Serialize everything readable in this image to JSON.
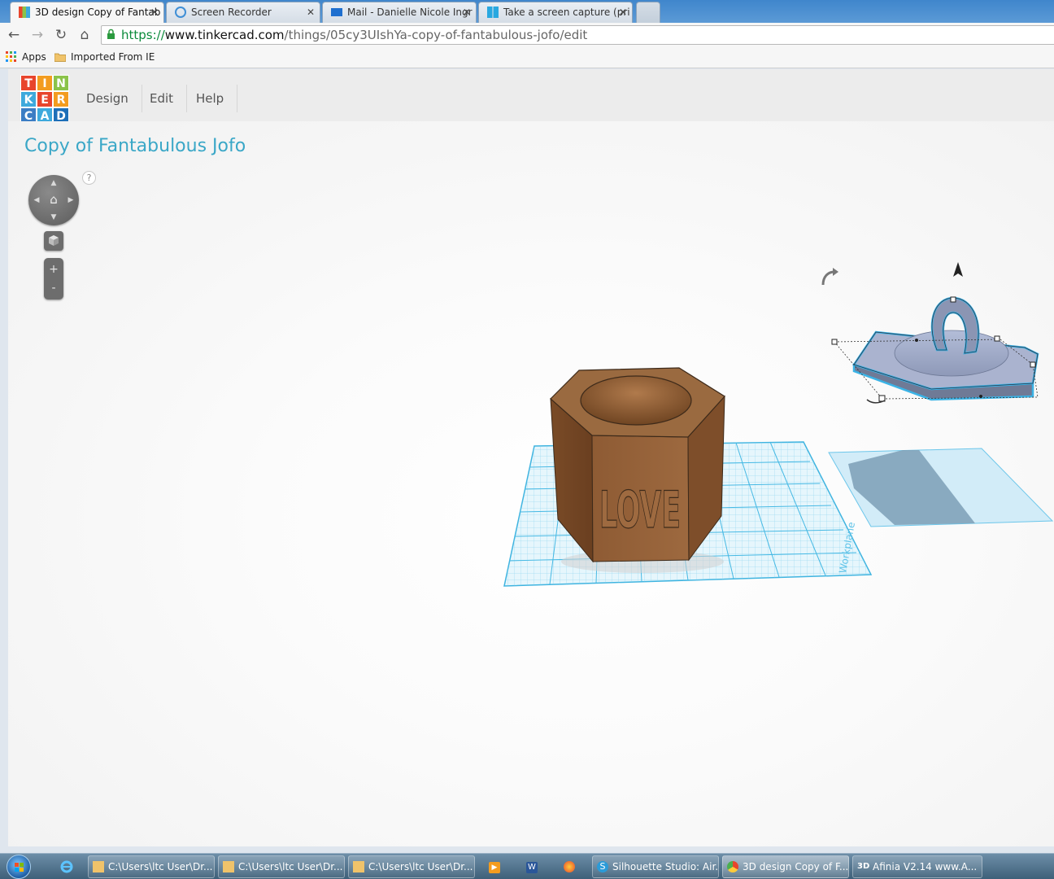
{
  "browser": {
    "tabs": [
      {
        "title": "3D design Copy of Fantab",
        "active": true
      },
      {
        "title": "Screen Recorder",
        "active": false
      },
      {
        "title": "Mail - Danielle Nicole Ingr",
        "active": false
      },
      {
        "title": "Take a screen capture (pri",
        "active": false
      }
    ],
    "close_glyph": "✕",
    "address": {
      "scheme": "https://",
      "host": "www.tinkercad.com",
      "path": "/things/05cy3UIshYa-copy-of-fantabulous-jofo/edit"
    },
    "bookmarks": [
      {
        "label": "Apps",
        "icon": "apps-grid-icon"
      },
      {
        "label": "Imported From IE",
        "icon": "folder-icon"
      }
    ]
  },
  "app": {
    "logo_letters": [
      "T",
      "I",
      "N",
      "K",
      "E",
      "R",
      "C",
      "A",
      "D"
    ],
    "logo_colors": [
      "#e8452c",
      "#f39c1f",
      "#8bc34a",
      "#3ea9dc",
      "#e8452c",
      "#f39c1f",
      "#3b7dc4",
      "#3ea9dc",
      "#1d6fb8"
    ],
    "menu": [
      "Design",
      "Edit",
      "Help"
    ],
    "design_title": "Copy of Fantabulous Jofo",
    "help_glyph": "?",
    "zoom_in": "+",
    "zoom_out": "-",
    "accent_color": "#3aa7c7"
  },
  "scene": {
    "workplane_label": "Workplane",
    "object_text": "LOVE",
    "object_color": "#8a5a34",
    "selection_color": "#3bb3e6"
  },
  "taskbar": {
    "items": [
      {
        "label": "C:\\Users\\ltc User\\Dr...",
        "icon": "folder-icon"
      },
      {
        "label": "C:\\Users\\ltc User\\Dr...",
        "icon": "folder-icon"
      },
      {
        "label": "C:\\Users\\ltc User\\Dr...",
        "icon": "folder-icon"
      },
      {
        "label": "Silhouette Studio: Air...",
        "icon": "silhouette-icon"
      },
      {
        "label": "3D design Copy of F...",
        "icon": "chrome-icon"
      },
      {
        "label": "Afinia  V2.14  www.A...",
        "icon": "afinia-icon"
      }
    ],
    "afinia_icon_text": "3D"
  }
}
